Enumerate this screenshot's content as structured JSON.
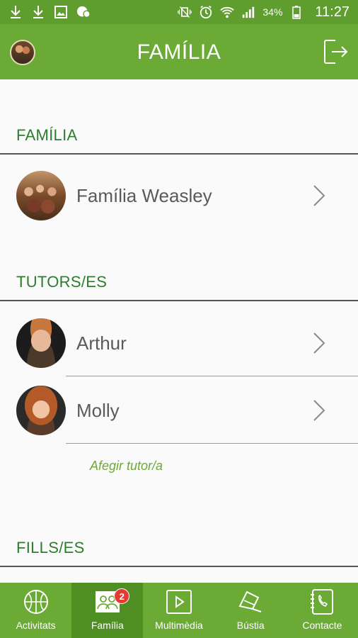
{
  "status_bar": {
    "battery": "34%",
    "time": "11:27",
    "icons": [
      "download-icon",
      "download-icon",
      "image-icon",
      "chat-icon",
      "vibrate-icon",
      "alarm-icon",
      "wifi-icon",
      "signal-icon",
      "battery-icon"
    ]
  },
  "app_bar": {
    "title": "FAMÍLIA"
  },
  "sections": {
    "family": {
      "header": "FAMÍLIA",
      "items": [
        {
          "label": "Família Weasley"
        }
      ]
    },
    "tutors": {
      "header": "TUTORS/ES",
      "items": [
        {
          "label": "Arthur"
        },
        {
          "label": "Molly"
        }
      ],
      "add_label": "Afegir tutor/a"
    },
    "children": {
      "header": "FILLS/ES"
    }
  },
  "bottom_nav": {
    "items": [
      {
        "label": "Activitats",
        "icon": "basketball-icon"
      },
      {
        "label": "Família",
        "icon": "family-icon",
        "badge": "2"
      },
      {
        "label": "Multimèdia",
        "icon": "play-icon"
      },
      {
        "label": "Bústia",
        "icon": "mailbox-icon"
      },
      {
        "label": "Contacte",
        "icon": "phone-icon"
      }
    ]
  },
  "colors": {
    "primary": "#6aaa35",
    "status_bar": "#5f9e2e",
    "active_tab": "#4f8e22",
    "section_header": "#2e7d2e",
    "badge": "#e53935"
  }
}
